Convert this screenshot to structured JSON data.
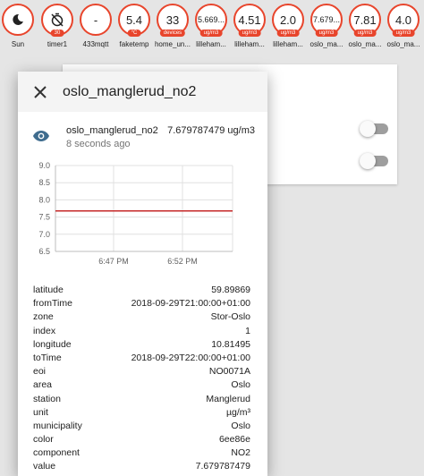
{
  "badges": [
    {
      "icon": "moon-icon",
      "value": "",
      "unit": "",
      "label": "Sun"
    },
    {
      "icon": "timer-off-icon",
      "value": "",
      "unit": "30",
      "label": "timer1"
    },
    {
      "icon": "",
      "value": "-",
      "unit": "",
      "label": "433mqtt"
    },
    {
      "icon": "",
      "value": "5.4",
      "unit": "°C",
      "label": "faketemp"
    },
    {
      "icon": "",
      "value": "33",
      "unit": "devices",
      "label": "home_un..."
    },
    {
      "icon": "",
      "value": "5.669...",
      "unit": "ug/m3",
      "label": "lilleham..."
    },
    {
      "icon": "",
      "value": "4.51",
      "unit": "ug/m3",
      "label": "lilleham..."
    },
    {
      "icon": "",
      "value": "2.0",
      "unit": "ug/m3",
      "label": "lilleham..."
    },
    {
      "icon": "",
      "value": "7.679...",
      "unit": "ug/m3",
      "label": "oslo_ma..."
    },
    {
      "icon": "",
      "value": "7.81",
      "unit": "ug/m3",
      "label": "oslo_ma..."
    },
    {
      "icon": "",
      "value": "4.0",
      "unit": "ug/m3",
      "label": "oslo_ma..."
    }
  ],
  "dialog": {
    "title": "oslo_manglerud_no2",
    "close_icon": "close-icon",
    "state": {
      "icon": "eye-icon",
      "name": "oslo_manglerud_no2",
      "time": "8 seconds ago",
      "value": "7.679787479 ug/m3"
    },
    "attributes": [
      {
        "key": "latitude",
        "value": "59.89869"
      },
      {
        "key": "fromTime",
        "value": "2018-09-29T21:00:00+01:00"
      },
      {
        "key": "zone",
        "value": "Stor-Oslo"
      },
      {
        "key": "index",
        "value": "1"
      },
      {
        "key": "longitude",
        "value": "10.81495"
      },
      {
        "key": "toTime",
        "value": "2018-09-29T22:00:00+01:00"
      },
      {
        "key": "eoi",
        "value": "NO0071A"
      },
      {
        "key": "area",
        "value": "Oslo"
      },
      {
        "key": "station",
        "value": "Manglerud"
      },
      {
        "key": "unit",
        "value": "µg/m³"
      },
      {
        "key": "municipality",
        "value": "Oslo"
      },
      {
        "key": "color",
        "value": "6ee86e"
      },
      {
        "key": "component",
        "value": "NO2"
      },
      {
        "key": "value",
        "value": "7.679787479"
      }
    ]
  },
  "chart_data": {
    "type": "line",
    "ylim": [
      6.5,
      9.0
    ],
    "yticks": [
      "9.0",
      "8.5",
      "8.0",
      "7.5",
      "7.0",
      "6.5"
    ],
    "xticks": [
      "6:47 PM",
      "6:52 PM"
    ],
    "series": [
      {
        "values": [
          7.68,
          7.68
        ]
      }
    ],
    "line_color": "#c62828"
  },
  "colors": {
    "accent": "#e8452c",
    "eye": "#3f6c8e"
  }
}
